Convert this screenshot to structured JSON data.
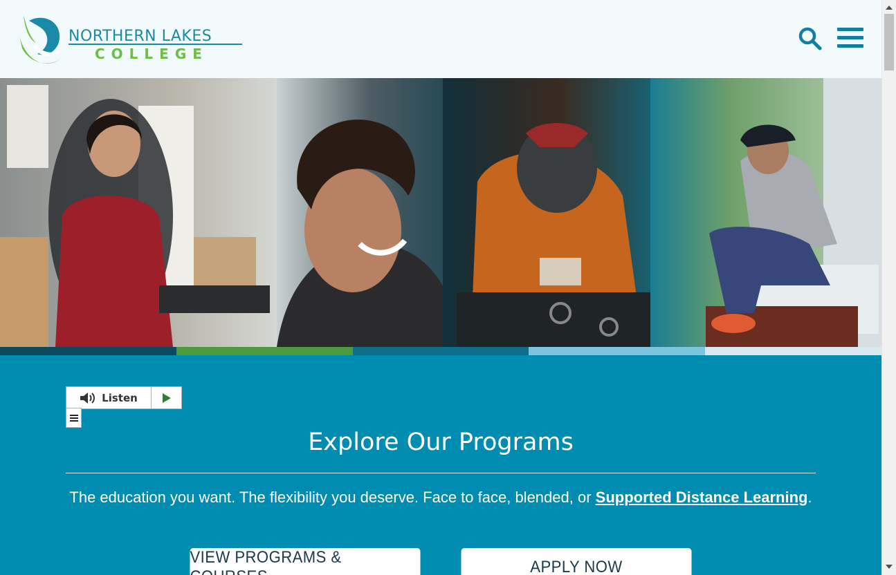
{
  "brand": {
    "name_top": "NORTHERN LAKES",
    "name_bottom": "COLLEGE",
    "colors": {
      "primary": "#1b8aa6",
      "secondary": "#6cbe45",
      "section_bg": "#008bb0"
    }
  },
  "header": {
    "search_icon": "search-icon",
    "menu_icon": "hamburger-menu-icon"
  },
  "hero": {
    "panels": [
      "receptionist-on-phone",
      "smiling-student",
      "welder-at-work",
      "student-with-phone"
    ],
    "strip_colors": [
      "#0b4a5c",
      "#4c9a3e",
      "#0d6f8c",
      "#7cc5dc",
      "#d8e8ee"
    ]
  },
  "listen": {
    "label": "Listen",
    "speaker_icon": "speaker-icon",
    "play_icon": "play-icon",
    "menu_icon": "menu-lines-icon"
  },
  "main": {
    "title": "Explore Our Programs",
    "tagline_text": "The education you want. The flexibility you deserve. Face to face, blended, or ",
    "tagline_link": "Supported Distance Learning",
    "tagline_end": ".",
    "buttons": [
      {
        "label": "VIEW PROGRAMS & COURSES"
      },
      {
        "label": "APPLY NOW"
      }
    ]
  }
}
